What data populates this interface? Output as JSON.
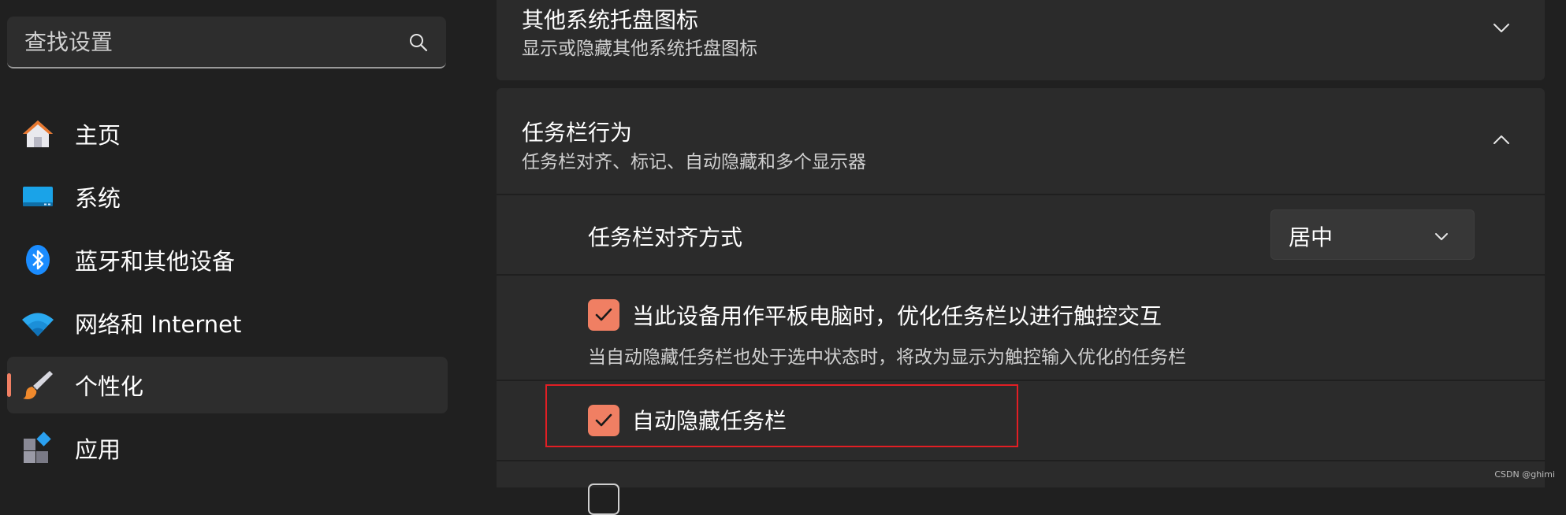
{
  "search": {
    "placeholder": "查找设置"
  },
  "sidebar": {
    "items": [
      {
        "label": "主页",
        "icon": "home-icon"
      },
      {
        "label": "系统",
        "icon": "system-monitor-icon"
      },
      {
        "label": "蓝牙和其他设备",
        "icon": "bluetooth-icon"
      },
      {
        "label": "网络和 Internet",
        "icon": "wifi-icon"
      },
      {
        "label": "个性化",
        "icon": "paintbrush-icon",
        "active": true
      },
      {
        "label": "应用",
        "icon": "apps-icon"
      }
    ]
  },
  "main": {
    "tray_card": {
      "title": "其他系统托盘图标",
      "subtitle": "显示或隐藏其他系统托盘图标",
      "expanded": false
    },
    "behavior_card": {
      "title": "任务栏行为",
      "subtitle": "任务栏对齐、标记、自动隐藏和多个显示器",
      "expanded": true
    },
    "alignment": {
      "label": "任务栏对齐方式",
      "selected": "居中"
    },
    "tablet_optimize": {
      "label": "当此设备用作平板电脑时，优化任务栏以进行触控交互",
      "description": "当自动隐藏任务栏也处于选中状态时，将改为显示为触控输入优化的任务栏",
      "checked": true
    },
    "auto_hide": {
      "label": "自动隐藏任务栏",
      "checked": true
    }
  },
  "colors": {
    "accent": "#f07f63",
    "highlight_border": "#e21e24",
    "background": "#202020",
    "card": "#2b2b2b"
  },
  "watermark": "CSDN @ghimi"
}
